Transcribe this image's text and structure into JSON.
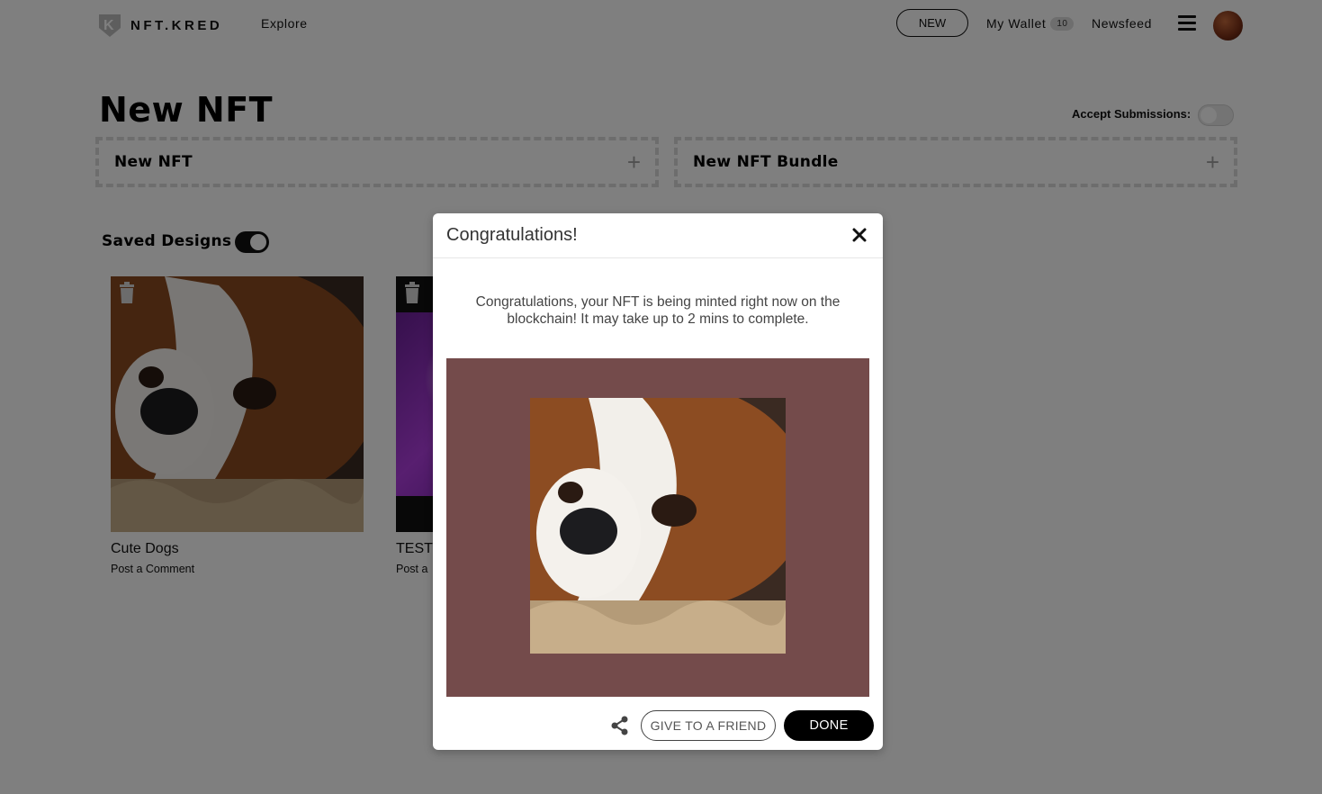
{
  "header": {
    "logo_text": "NFT.KRED",
    "logo_letter": "K",
    "nav_explore": "Explore",
    "btn_new": "NEW",
    "nav_wallet": "My Wallet",
    "wallet_count": "10",
    "nav_newsfeed": "Newsfeed"
  },
  "main": {
    "title": "New NFT",
    "accept_label": "Accept Submissions:",
    "new_nft_label": "New NFT",
    "new_bundle_label": "New NFT Bundle",
    "plus_symbol": "+",
    "saved_designs_label": "Saved Designs",
    "cards": [
      {
        "title": "Cute Dogs",
        "sub": "Post a Comment"
      },
      {
        "title": "TEST",
        "sub": "Post a"
      }
    ]
  },
  "modal": {
    "title": "Congratulations!",
    "close_symbol": "×",
    "message": "Congratulations, your NFT is being minted right now on the blockchain! It may take up to 2 mins to complete.",
    "give_label": "GIVE TO A FRIEND",
    "done_label": "DONE"
  },
  "colors": {
    "accent": "#000000",
    "nft_frame": "#744b4b",
    "overlay": "#808080"
  }
}
